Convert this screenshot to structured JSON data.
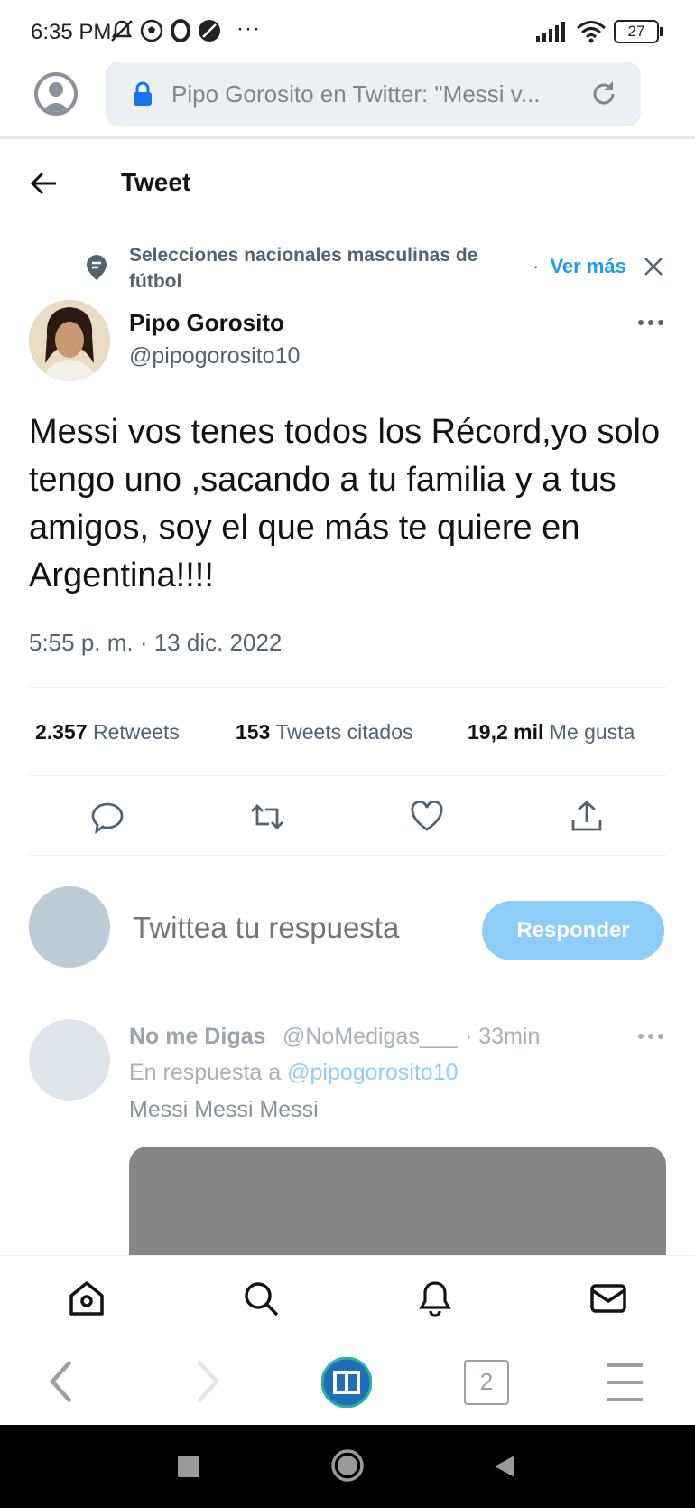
{
  "status_bar": {
    "time": "6:35 PM",
    "more": "···",
    "battery": "27"
  },
  "browser": {
    "url_text": "Pipo Gorosito en Twitter: \"Messi v...",
    "tab_count": "2"
  },
  "header": {
    "title": "Tweet"
  },
  "topic": {
    "label": "Selecciones nacionales masculinas de fútbol",
    "separator": "·",
    "more_link": "Ver más"
  },
  "tweet": {
    "author_name": "Pipo Gorosito",
    "author_handle": "@pipogorosito10",
    "text": "Messi vos tenes todos los Récord,yo solo tengo uno ,sacando a tu familia y a tus amigos, soy el que más te quiere en Argentina!!!!",
    "timestamp": "5:55 p. m. · 13 dic. 2022",
    "stats": {
      "retweets_count": "2.357",
      "retweets_label": "Retweets",
      "quotes_count": "153",
      "quotes_label": "Tweets citados",
      "likes_count": "19,2 mil",
      "likes_label": "Me gusta"
    }
  },
  "composer": {
    "placeholder": "Twittea tu respuesta",
    "reply_button": "Responder"
  },
  "reply": {
    "name": "No me Digas",
    "handle": "@NoMedigas___",
    "time": "· 33min",
    "in_reply_prefix": "En respuesta a",
    "in_reply_handle": "@pipogorosito10",
    "text": "Messi Messi Messi"
  },
  "colors": {
    "accent": "#1d9bf0",
    "reply_button_disabled": "#8ecdf8",
    "secondary_text": "#536471"
  },
  "icons": {
    "nav": [
      "home-icon",
      "search-icon",
      "notifications-icon",
      "messages-icon"
    ],
    "actions": [
      "reply-icon",
      "retweet-icon",
      "like-icon",
      "share-icon"
    ]
  }
}
